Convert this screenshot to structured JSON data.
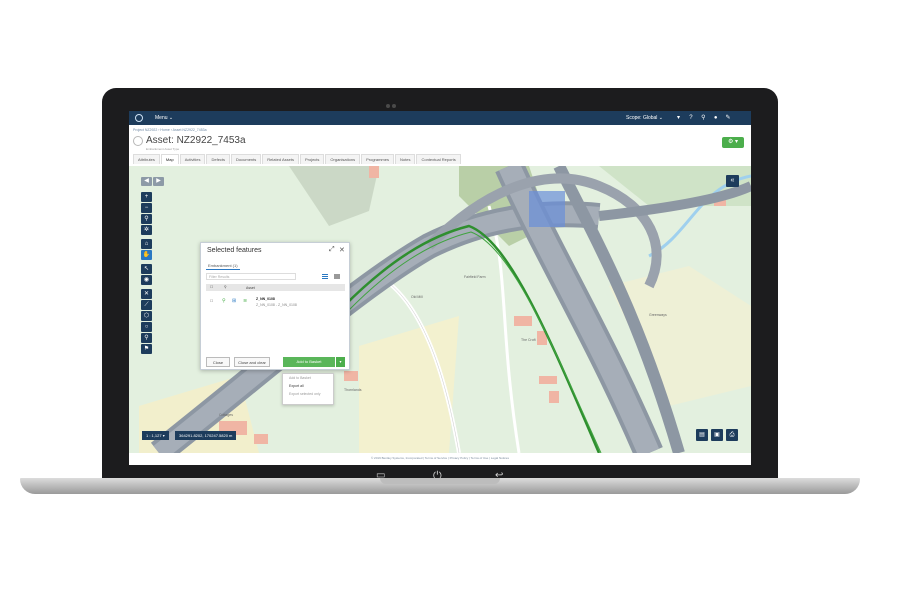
{
  "topbar": {
    "menu_label": "Menu",
    "scope_label": "Scope: Global"
  },
  "breadcrumb": "Project NZ2922 › Home › Asset NZ2922_7453a",
  "asset": {
    "title": "Asset: NZ2922_7453a",
    "subtitle": "Embankment Asset Type"
  },
  "tabs": [
    {
      "label": "Attributes",
      "active": false
    },
    {
      "label": "Map",
      "active": true
    },
    {
      "label": "Activities",
      "active": false
    },
    {
      "label": "Defects",
      "active": false
    },
    {
      "label": "Documents",
      "active": false
    },
    {
      "label": "Related Assets",
      "active": false
    },
    {
      "label": "Projects",
      "active": false
    },
    {
      "label": "Organisations",
      "active": false
    },
    {
      "label": "Programmes",
      "active": false
    },
    {
      "label": "Notes",
      "active": false
    },
    {
      "label": "Contextual Reports",
      "active": false
    }
  ],
  "map": {
    "scale_label": "1 : 1,127",
    "coords_label": "364291.8202, 170247.5820 m",
    "labels": [
      "Fairfield Farm",
      "Old Mill",
      "The Croft",
      "Cottages",
      "Thornlands",
      "Greenways"
    ]
  },
  "panel": {
    "title": "Selected features",
    "tab_label": "Embankment (1)",
    "search_placeholder": "Filter Results",
    "column_asset": "Asset",
    "row_name": "Z_NN_0108",
    "row_sub": "Z_NN_0108 - Z_NN_0108",
    "btn_close": "Close",
    "btn_close_clear": "Close and clear",
    "btn_add_basket": "Add to Basket"
  },
  "dropdown": {
    "items": [
      {
        "label": "Add to Basket",
        "enabled": false
      },
      {
        "label": "Export all",
        "enabled": true
      },
      {
        "label": "Export selected only",
        "enabled": false
      }
    ]
  },
  "footer": "© 2019 Bentley Systems, Incorporated | Terms of Service | Privacy Policy | Terms of Use | Legal Notices",
  "colors": {
    "topbar": "#1d3c5c",
    "accent_green": "#4cae4c",
    "map_bg": "#dfeedd",
    "road": "#8d97a3",
    "highlight": "#2f8f2f"
  }
}
